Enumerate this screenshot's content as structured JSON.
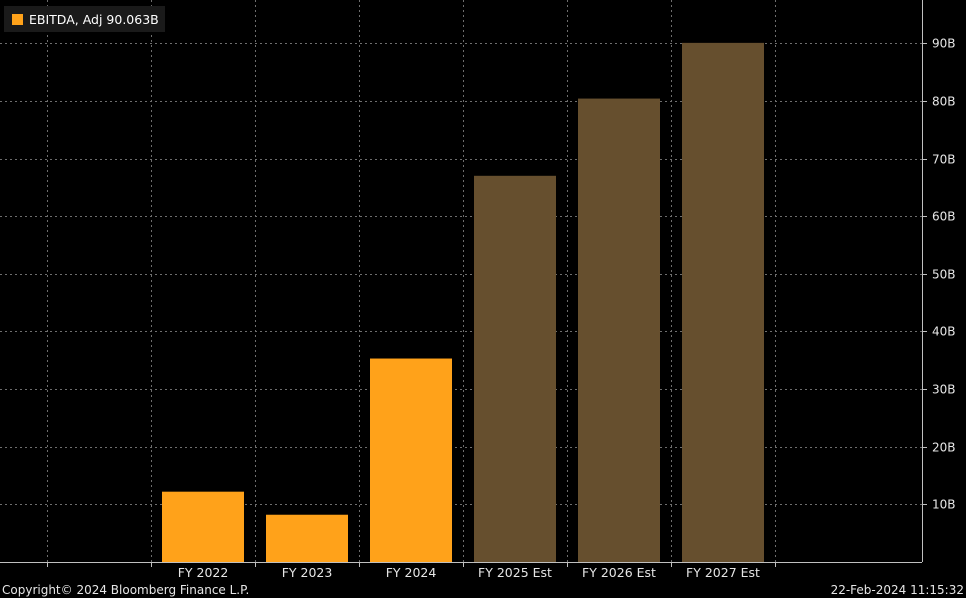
{
  "legend": {
    "label": "EBITDA, Adj 90.063B",
    "color": "#ffa21a"
  },
  "footer": {
    "copyright": "Copyright© 2024 Bloomberg Finance L.P.",
    "timestamp": "22-Feb-2024 11:15:32"
  },
  "colors": {
    "background": "#000000",
    "grid": "#6e6e6e",
    "actual": "#ffa21a",
    "estimate": "#664f2e",
    "text": "#e6e6e6"
  },
  "chart_data": {
    "type": "bar",
    "categories": [
      "FY 2022",
      "FY 2023",
      "FY 2024",
      "FY 2025 Est",
      "FY 2026 Est",
      "FY 2027 Est"
    ],
    "values": [
      12.2,
      8.2,
      35.3,
      67.0,
      80.4,
      90.063
    ],
    "estimate": [
      false,
      false,
      false,
      true,
      true,
      true
    ],
    "ylim": [
      0,
      97.5
    ],
    "yticks": [
      10,
      20,
      30,
      40,
      50,
      60,
      70,
      80,
      90
    ],
    "ytick_labels": [
      "10B",
      "20B",
      "30B",
      "40B",
      "50B",
      "60B",
      "70B",
      "80B",
      "90B"
    ],
    "y_axis_side": "right",
    "grid": true
  }
}
